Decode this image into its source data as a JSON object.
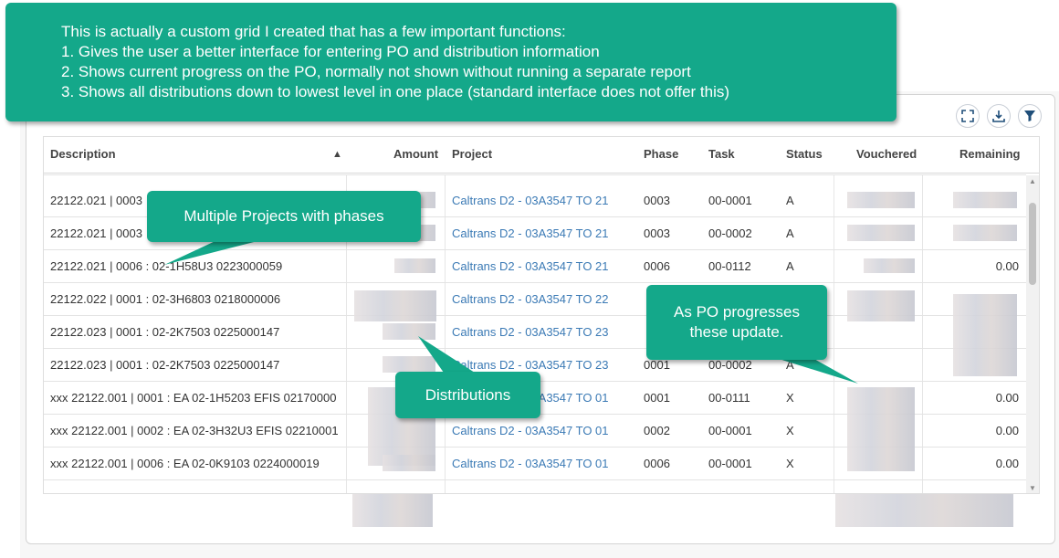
{
  "toolbar": {
    "icons": [
      "expand-icon",
      "download-icon",
      "filter-icon"
    ]
  },
  "grid": {
    "columns": {
      "description": "Description",
      "amount": "Amount",
      "project": "Project",
      "phase": "Phase",
      "task": "Task",
      "status": "Status",
      "vouchered": "Vouchered",
      "remaining": "Remaining"
    },
    "sort": "ascending",
    "rows": [
      {
        "description": "22122.021 | 0003",
        "project": "Caltrans D2 - 03A3547 TO 21",
        "phase": "0003",
        "task": "00-0001",
        "status": "A",
        "remaining": ""
      },
      {
        "description": "22122.021 | 0003",
        "project": "Caltrans D2 - 03A3547 TO 21",
        "phase": "0003",
        "task": "00-0002",
        "status": "A",
        "remaining": ""
      },
      {
        "description": "22122.021 | 0006 : 02-1H58U3 0223000059",
        "project": "Caltrans D2 - 03A3547 TO 21",
        "phase": "0006",
        "task": "00-0112",
        "status": "A",
        "remaining": "0.00"
      },
      {
        "description": "22122.022 | 0001 : 02-3H6803 0218000006",
        "project": "Caltrans D2 - 03A3547 TO 22",
        "phase": "",
        "task": "",
        "status": "",
        "remaining": ""
      },
      {
        "description": "22122.023 | 0001 : 02-2K7503 0225000147",
        "project": "Caltrans D2 - 03A3547 TO 23",
        "phase": "",
        "task": "",
        "status": "",
        "remaining": ""
      },
      {
        "description": "22122.023 | 0001 : 02-2K7503 0225000147",
        "project": "Caltrans D2 - 03A3547 TO 23",
        "phase": "0001",
        "task": "00-0002",
        "status": "A",
        "remaining": ""
      },
      {
        "description": "xxx 22122.001 | 0001 : EA 02-1H5203 EFIS 02170000",
        "project": "Caltrans D2 - 03A3547 TO 01",
        "phase": "0001",
        "task": "00-0111",
        "status": "X",
        "remaining": "0.00"
      },
      {
        "description": "xxx 22122.001 | 0002 : EA 02-3H32U3 EFIS 02210001",
        "project": "Caltrans D2 - 03A3547 TO 01",
        "phase": "0002",
        "task": "00-0001",
        "status": "X",
        "remaining": "0.00"
      },
      {
        "description": "xxx 22122.001 | 0006 : EA 02-0K9103 0224000019",
        "project": "Caltrans D2 - 03A3547 TO 01",
        "phase": "0006",
        "task": "00-0001",
        "status": "X",
        "remaining": "0.00"
      }
    ]
  },
  "callouts": {
    "main": {
      "lines": [
        "This is actually a custom grid I created that has a few important functions:",
        "1. Gives the user a better interface for entering PO and distribution information",
        "2. Shows current progress on the PO, normally not shown without running a separate report",
        "3. Shows all distributions down to lowest level in one place (standard interface does not offer this)"
      ]
    },
    "projects": "Multiple Projects with phases",
    "distributions": "Distributions",
    "progress_line1": "As PO progresses",
    "progress_line2": "these update."
  },
  "colors": {
    "callout": "#14a88a",
    "link": "#3b7ab5"
  }
}
